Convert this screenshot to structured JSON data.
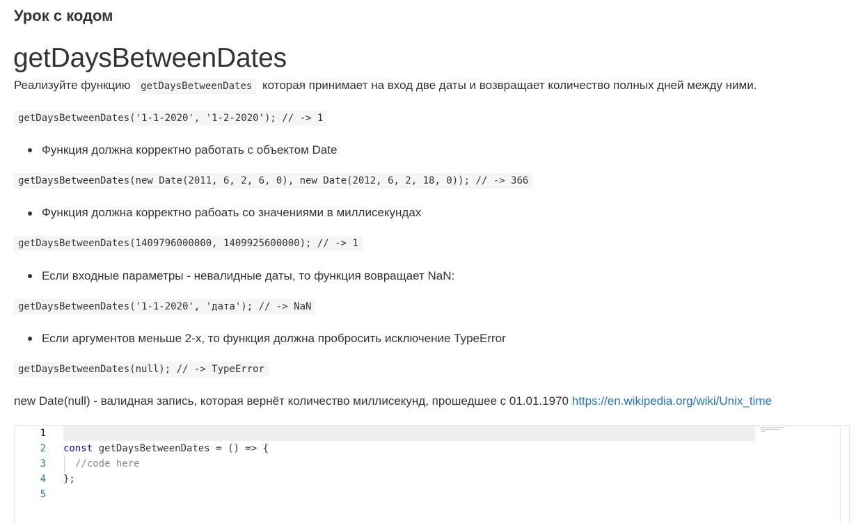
{
  "lesson_label": "Урок с кодом",
  "task": {
    "title": "getDaysBetweenDates",
    "intro_before": "Реализуйте функцию",
    "intro_code": "getDaysBetweenDates",
    "intro_after": "которая принимает на вход две даты и возвращает количество полных дней между ними."
  },
  "examples": [
    "getDaysBetweenDates('1-1-2020', '1-2-2020'); // -> 1",
    "getDaysBetweenDates(new Date(2011, 6, 2, 6, 0), new Date(2012, 6, 2, 18, 0)); // -> 366",
    "getDaysBetweenDates(1409796000000, 1409925600000); // -> 1",
    "getDaysBetweenDates('1-1-2020', 'дата'); // -> NaN",
    "getDaysBetweenDates(null); // -> TypeError"
  ],
  "bullets": [
    "Функция должна корректно работать с объектом Date",
    "Функция должна корректно рабоать со значениями в миллисекундах",
    "Если входные параметры - невалидные даты, то функция вовращает NaN:",
    "Если аргументов меньше 2-х, то функция должна пробросить исключение TypeError"
  ],
  "note": {
    "text": "new Date(null) - валидная запись, которая вернёт количество миллисекунд, прошедшее с 01.01.1970",
    "link_text": "https://en.wikipedia.org/wiki/Unix_time",
    "link_href": "https://en.wikipedia.org/wiki/Unix_time"
  },
  "editor": {
    "line_numbers": [
      "1",
      "2",
      "3",
      "4",
      "5"
    ],
    "line2_keyword": "const",
    "line2_rest": " getDaysBetweenDates = () => {",
    "line3_comment": "  //code here",
    "line4": "};"
  },
  "colors": {
    "text": "#333333",
    "link": "#1a73c9",
    "keyword": "#0000ff",
    "comment": "#8a8a8a",
    "line_number": "#237893",
    "code_background": "#f5f5f5"
  }
}
